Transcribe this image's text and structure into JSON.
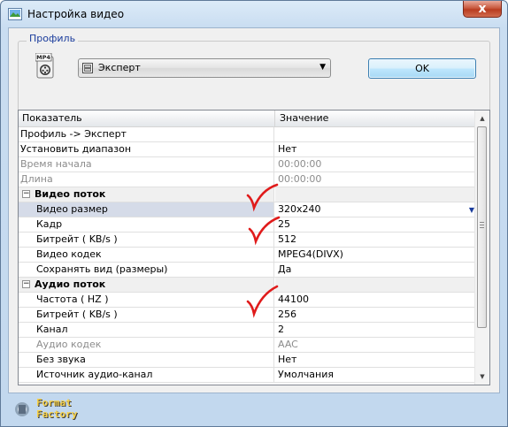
{
  "window": {
    "title": "Настройка видео",
    "close_label": "x"
  },
  "profile": {
    "group_label": "Профиль",
    "icon_text": "MP4",
    "selected": "Эксперт",
    "ok_label": "OK"
  },
  "grid": {
    "col_param": "Показатель",
    "col_value": "Значение",
    "rows": [
      {
        "name": "Профиль -> Эксперт",
        "value": ""
      },
      {
        "name": "Установить диапазон",
        "value": "Нет"
      },
      {
        "name": "Время начала",
        "value": "00:00:00"
      },
      {
        "name": "Длина",
        "value": "00:00:00"
      },
      {
        "name": "Видео поток",
        "value": ""
      },
      {
        "name": "Видео размер",
        "value": "320x240"
      },
      {
        "name": "Кадр",
        "value": "25"
      },
      {
        "name": "Битрейт ( KB/s )",
        "value": "512"
      },
      {
        "name": "Видео кодек",
        "value": "MPEG4(DIVX)"
      },
      {
        "name": "Сохранять вид (размеры)",
        "value": "Да"
      },
      {
        "name": "Аудио поток",
        "value": ""
      },
      {
        "name": "Частота ( HZ )",
        "value": "44100"
      },
      {
        "name": "Битрейт ( KB/s )",
        "value": "256"
      },
      {
        "name": "Канал",
        "value": "2"
      },
      {
        "name": "Аудио кодек",
        "value": "AAC"
      },
      {
        "name": "Без звука",
        "value": "Нет"
      },
      {
        "name": "Источник аудио-канал",
        "value": "Умолчания"
      }
    ],
    "expander_minus": "−"
  },
  "footer": {
    "logo_line1": "Format",
    "logo_line2": "Factory"
  },
  "colors": {
    "accent_blue": "#1a3c9c",
    "check_red": "#e01b1b",
    "disabled_text": "#8c8c8c",
    "selected_row": "#d5dbe8"
  }
}
